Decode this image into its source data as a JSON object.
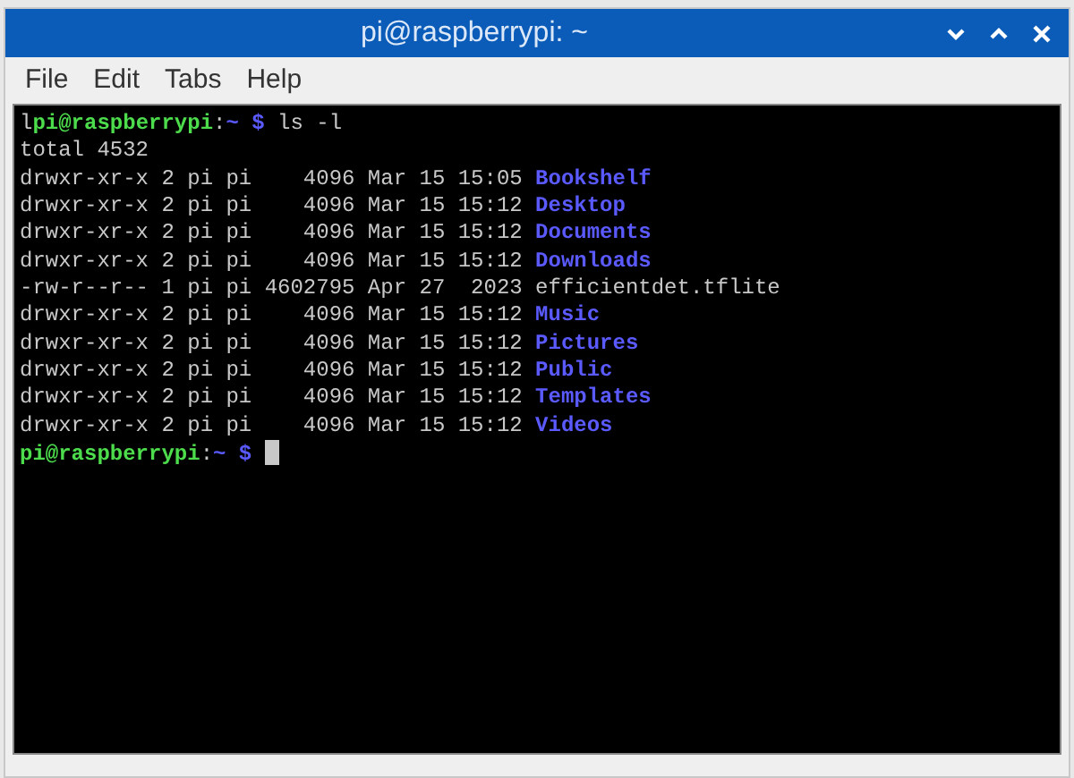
{
  "window": {
    "title": "pi@raspberrypi: ~"
  },
  "menu": [
    "File",
    "Edit",
    "Tabs",
    "Help"
  ],
  "terminal": {
    "lines": [
      [
        {
          "kind": "plain",
          "text": "l"
        },
        {
          "kind": "user",
          "text": "pi@raspberrypi"
        },
        {
          "kind": "plain",
          "text": ":"
        },
        {
          "kind": "path",
          "text": "~ $"
        },
        {
          "kind": "plain",
          "text": " ls -l"
        }
      ],
      [
        {
          "kind": "plain",
          "text": "total 4532"
        }
      ],
      [
        {
          "kind": "plain",
          "text": "drwxr-xr-x 2 pi pi    4096 Mar 15 15:05 "
        },
        {
          "kind": "dir",
          "text": "Bookshelf"
        }
      ],
      [
        {
          "kind": "plain",
          "text": "drwxr-xr-x 2 pi pi    4096 Mar 15 15:12 "
        },
        {
          "kind": "dir",
          "text": "Desktop"
        }
      ],
      [
        {
          "kind": "plain",
          "text": "drwxr-xr-x 2 pi pi    4096 Mar 15 15:12 "
        },
        {
          "kind": "dir",
          "text": "Documents"
        }
      ],
      [
        {
          "kind": "plain",
          "text": "drwxr-xr-x 2 pi pi    4096 Mar 15 15:12 "
        },
        {
          "kind": "dir",
          "text": "Downloads"
        }
      ],
      [
        {
          "kind": "plain",
          "text": "-rw-r--r-- 1 pi pi 4602795 Apr 27  2023 efficientdet.tflite"
        }
      ],
      [
        {
          "kind": "plain",
          "text": "drwxr-xr-x 2 pi pi    4096 Mar 15 15:12 "
        },
        {
          "kind": "dir",
          "text": "Music"
        }
      ],
      [
        {
          "kind": "plain",
          "text": "drwxr-xr-x 2 pi pi    4096 Mar 15 15:12 "
        },
        {
          "kind": "dir",
          "text": "Pictures"
        }
      ],
      [
        {
          "kind": "plain",
          "text": "drwxr-xr-x 2 pi pi    4096 Mar 15 15:12 "
        },
        {
          "kind": "dir",
          "text": "Public"
        }
      ],
      [
        {
          "kind": "plain",
          "text": "drwxr-xr-x 2 pi pi    4096 Mar 15 15:12 "
        },
        {
          "kind": "dir",
          "text": "Templates"
        }
      ],
      [
        {
          "kind": "plain",
          "text": "drwxr-xr-x 2 pi pi    4096 Mar 15 15:12 "
        },
        {
          "kind": "dir",
          "text": "Videos"
        }
      ],
      [
        {
          "kind": "user",
          "text": "pi@raspberrypi"
        },
        {
          "kind": "plain",
          "text": ":"
        },
        {
          "kind": "path",
          "text": "~ $"
        },
        {
          "kind": "cursor"
        }
      ]
    ]
  }
}
